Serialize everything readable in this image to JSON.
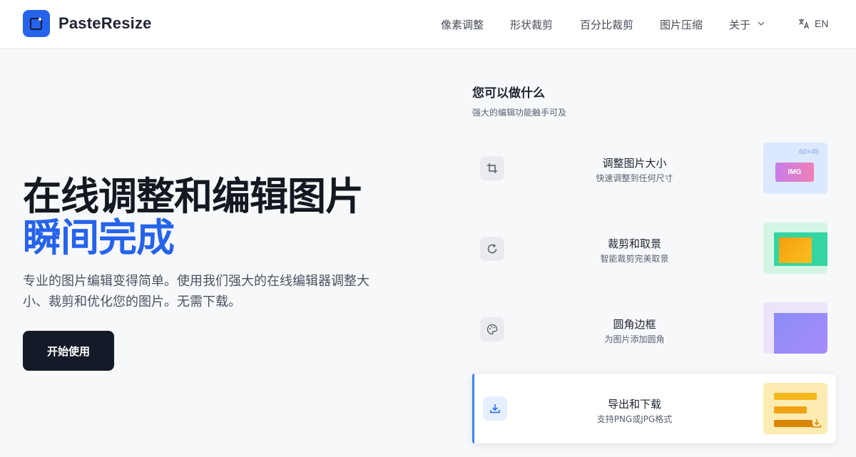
{
  "header": {
    "brand": "PasteResize",
    "nav": [
      "像素调整",
      "形状裁剪",
      "百分比裁剪",
      "图片压缩",
      "关于"
    ],
    "lang": "EN"
  },
  "hero": {
    "title": "在线调整和编辑图片",
    "accent": "瞬间完成",
    "description": "专业的图片编辑变得简单。使用我们强大的在线编辑器调整大小、裁剪和优化您的图片。无需下载。",
    "cta": "开始使用"
  },
  "panel": {
    "title": "您可以做什么",
    "subtitle": "强大的编辑功能触手可及",
    "features": [
      {
        "title": "调整图片大小",
        "desc": "快速调整到任何尺寸",
        "icon": "crop-icon",
        "thumb_label": "IMG",
        "thumb_size": "60×45"
      },
      {
        "title": "裁剪和取景",
        "desc": "智能裁剪完美取景",
        "icon": "rotate-icon"
      },
      {
        "title": "圆角边框",
        "desc": "为图片添加圆角",
        "icon": "palette-icon"
      },
      {
        "title": "导出和下载",
        "desc": "支持PNG或JPG格式",
        "icon": "download-icon"
      }
    ]
  },
  "colors": {
    "accent": "#2563eb",
    "dark": "#141a27"
  }
}
